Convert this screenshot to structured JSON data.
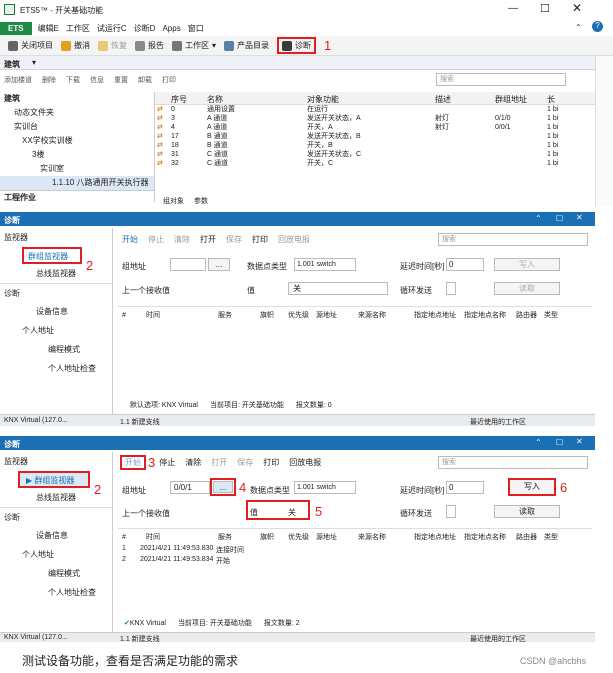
{
  "window": {
    "title": "ETS5™ - 开关基础功能"
  },
  "menu": [
    "ETS",
    "编辑E",
    "工作区",
    "试运行C",
    "诊断D",
    "Apps",
    "窗口"
  ],
  "toolbar": {
    "close_project": "关闭项目",
    "undo": "撤消",
    "redo": "恢复",
    "report": "报告",
    "workspace": "工作区",
    "catalog": "产品目录",
    "diagnostics": "诊断",
    "num1": "1"
  },
  "building": {
    "panel_title": "建筑",
    "toolbar": [
      "添加楼道",
      "删除",
      "下载",
      "信息",
      "重置",
      "卸载",
      "打印"
    ],
    "search_placeholder": "搜索",
    "tree": [
      "建筑",
      "动态文件夹",
      "实训台",
      "XX学校实训楼",
      "3楼",
      "实训室",
      "1.1.10 八路通用开关执行器",
      "工程作业"
    ],
    "columns": [
      "序号",
      "名称",
      "对象功能",
      "描述",
      "群组地址",
      "长"
    ],
    "rows": [
      [
        "0",
        "通用设置",
        "在运行",
        "",
        "",
        "1 bi"
      ],
      [
        "3",
        "A 通道",
        "发送开关状态，A",
        "射灯",
        "0/1/0",
        "1 bi"
      ],
      [
        "4",
        "A 通道",
        "开关，A",
        "射灯",
        "0/0/1",
        "1 bi"
      ],
      [
        "17",
        "B 通道",
        "发送开关状态，B",
        "",
        "",
        "1 bi"
      ],
      [
        "18",
        "B 通道",
        "开关，B",
        "",
        "",
        "1 bi"
      ],
      [
        "31",
        "C 通道",
        "发送开关状态，C",
        "",
        "",
        "1 bi"
      ],
      [
        "32",
        "C 通道",
        "开关，C",
        "",
        "",
        "1 bi"
      ]
    ],
    "tabs": [
      "组对象",
      "参数"
    ]
  },
  "diag1": {
    "title": "诊断",
    "side": [
      "监视器",
      "群组监视器",
      "总线监视器",
      "诊断",
      "设备信息",
      "个人地址",
      "编程模式",
      "个人地址检查",
      "KNX Virtual (127.0..."
    ],
    "num2": "2",
    "toolbar": [
      "开始",
      "停止",
      "清除",
      "打开",
      "保存",
      "打印",
      "回放电报"
    ],
    "search": "搜索",
    "group_addr_label": "组地址",
    "dpt_label": "数据点类型",
    "dpt_value": "1.001 switch",
    "delay_label": "延迟时间[秒]",
    "delay_value": "0",
    "write": "写入",
    "last_label": "上一个接收值",
    "value_label": "值",
    "value_value": "关",
    "cyclic_label": "循环发送",
    "read": "读取",
    "columns": [
      "#",
      "时间",
      "服务",
      "旗帜",
      "优先级",
      "源地址",
      "来源名称",
      "指定地点地址",
      "指定地点名称",
      "路由器",
      "类型"
    ],
    "bottom_default": "默认选项:",
    "bottom_knx": "KNX Virtual",
    "bottom_project_label": "当前项目:",
    "bottom_project": "开关基础功能",
    "bottom_count": "报文数量: 0",
    "status_left": "1.1 新建支线",
    "status_right": "最近使用的工作区"
  },
  "diag2": {
    "title": "诊断",
    "num2": "2",
    "num3": "3",
    "num4": "4",
    "num5": "5",
    "num6": "6",
    "group_addr_value": "0/0/1",
    "dpt_value": "1.001 switch",
    "delay_value": "0",
    "value_value": "关",
    "log": [
      [
        "1",
        "2021/4/21 11:49:53.830",
        "连接时间"
      ],
      [
        "2",
        "2021/4/21 11:49:53.834",
        "开始"
      ]
    ],
    "bottom_knx": "KNX Virtual",
    "bottom_project": "开关基础功能",
    "bottom_count": "报文数量: 2",
    "status_left": "KNX Virtual (127.0...",
    "status_mid": "1.1 新建支线",
    "status_right": "最近使用的工作区"
  },
  "caption": "测试设备功能，查看是否满足功能的需求",
  "watermark": "CSDN @ahcbhs"
}
